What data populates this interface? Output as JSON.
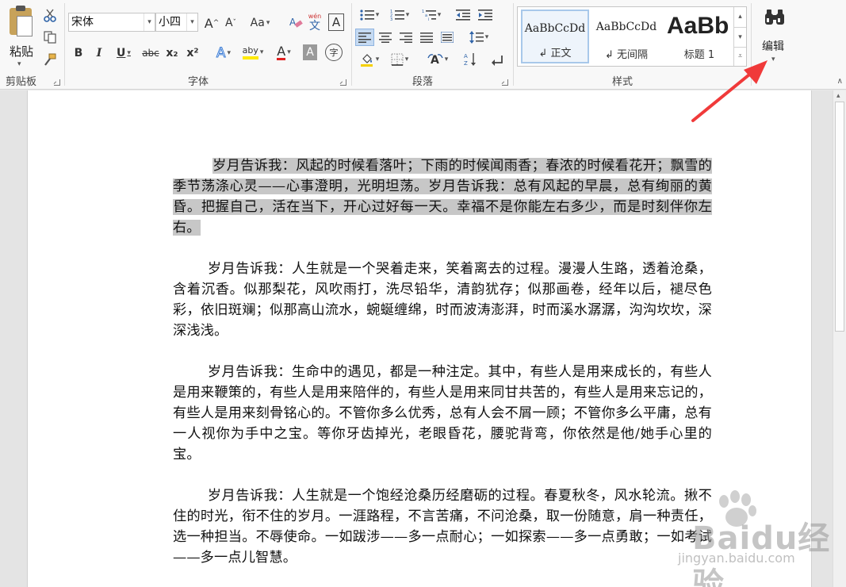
{
  "ribbon": {
    "clipboard": {
      "label": "剪贴板",
      "paste_label": "粘贴"
    },
    "font": {
      "label": "字体",
      "font_name": "宋体",
      "font_size": "小四",
      "grow_label": "A",
      "shrink_label": "A",
      "case_label": "Aa",
      "phonetic_label": "文",
      "phonetic_top": "wén",
      "border_char_label": "A",
      "bold": "B",
      "italic": "I",
      "underline": "U",
      "strike": "abc",
      "subscript": "x₂",
      "superscript": "x²",
      "effects": "A",
      "highlight": "aby",
      "font_color": "A",
      "shading": "A",
      "enclose": "字",
      "accent_red": "#e02020",
      "accent_yellow": "#ffea00"
    },
    "paragraph": {
      "label": "段落"
    },
    "styles": {
      "label": "样式",
      "items": [
        {
          "sample": "AaBbCcDd",
          "name": "↲ 正文"
        },
        {
          "sample": "AaBbCcDd",
          "name": "↲ 无间隔"
        },
        {
          "sample": "AaBb",
          "name": "标题 1"
        }
      ]
    },
    "editing": {
      "label": "编辑"
    }
  },
  "document": {
    "paragraphs": [
      "岁月告诉我：风起的时候看落叶；下雨的时候闻雨香；春浓的时候看花开；飘雪的季节荡涤心灵——心事澄明，光明坦荡。岁月告诉我：总有风起的早晨，总有绚丽的黄昏。把握自己，活在当下，开心过好每一天。幸福不是你能左右多少，而是时刻伴你左右。",
      "岁月告诉我：人生就是一个哭着走来，笑着离去的过程。漫漫人生路，透着沧桑，含着沉香。似那梨花，风吹雨打，洗尽铅华，清韵犹存；似那画卷，经年以后，褪尽色彩，依旧斑斓；似那高山流水，蜿蜒缠绵，时而波涛澎湃，时而溪水潺潺，沟沟坎坎，深深浅浅。",
      "岁月告诉我：生命中的遇见，都是一种注定。其中，有些人是用来成长的，有些人是用来鞭策的，有些人是用来陪伴的，有些人是用来同甘共苦的，有些人是用来忘记的，有些人是用来刻骨铭心的。不管你多么优秀，总有人会不屑一顾；不管你多么平庸，总有一人视你为手中之宝。等你牙齿掉光，老眼昏花，腰驼背弯，你依然是他/她手心里的宝。",
      "岁月告诉我：人生就是一个饱经沧桑历经磨砺的过程。春夏秋冬，风水轮流。揪不住的时光，衔不住的岁月。一涯路程，不言苦痛，不问沧桑，取一份随意，肩一种责任，选一种担当。不辱使命。一如跋涉——多一点耐心；一如探索——多一点勇敢；一如考试——多一点儿智慧。"
    ],
    "selection_color": "#c7c7c7"
  },
  "annotation": {
    "arrow_color": "#f03a3a"
  },
  "watermark": {
    "brand": "Baidu经验",
    "url": "jingyan.baidu.com"
  }
}
